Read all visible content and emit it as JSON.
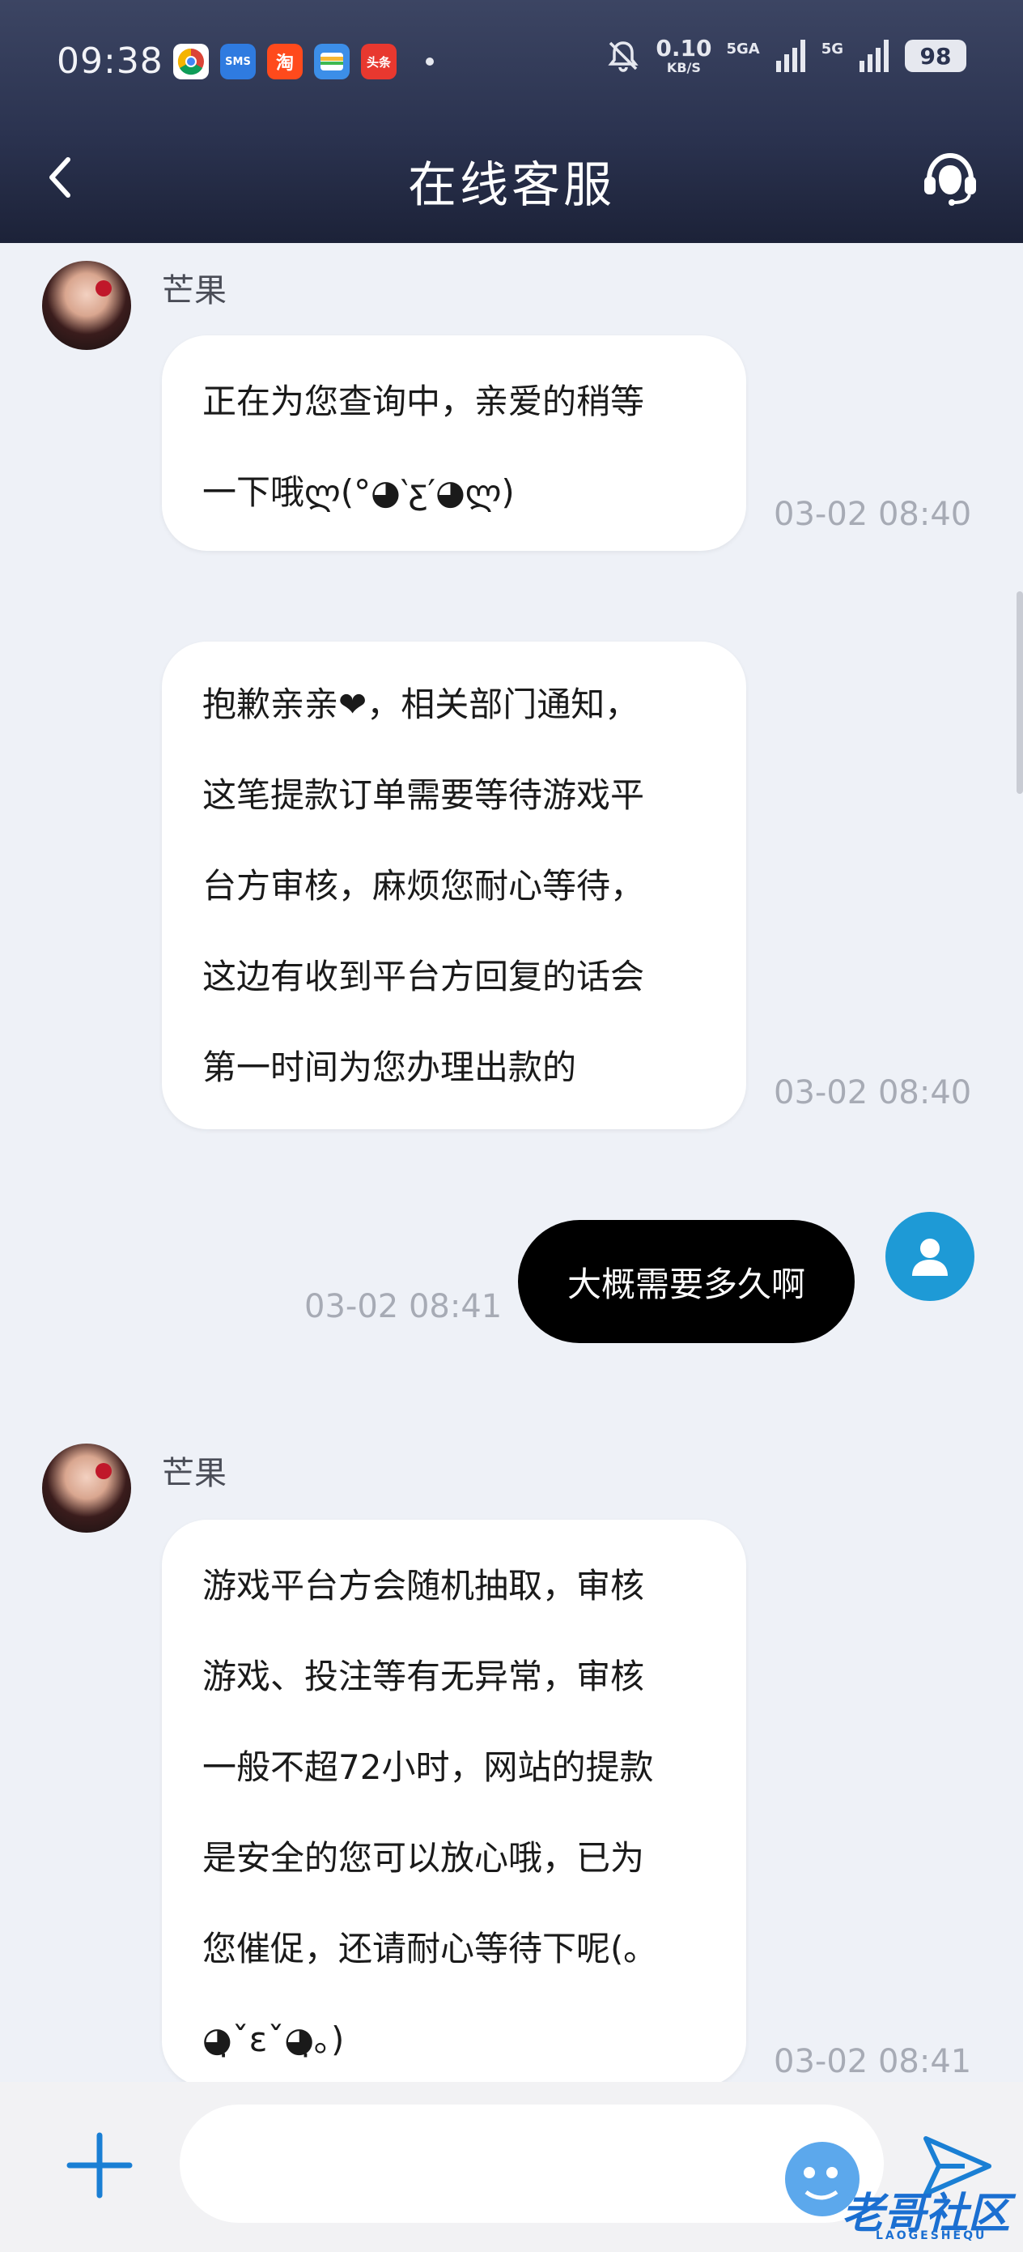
{
  "status_bar": {
    "time": "09:38",
    "apps": [
      {
        "icon": "chrome-icon",
        "color": "#ffffff",
        "label": ""
      },
      {
        "icon": "sms-icon",
        "color": "#2f7be0",
        "label": "SMS"
      },
      {
        "icon": "taobao-icon",
        "color": "#ff4a1c",
        "label": "淘"
      },
      {
        "icon": "wallet-icon",
        "color": "#3c8ee8",
        "label": ""
      },
      {
        "icon": "toutiao-icon",
        "color": "#e8382f",
        "label": "头条"
      }
    ],
    "net_speed_value": "0.10",
    "net_speed_unit": "KB/S",
    "signal1_label": "5GA",
    "signal2_label": "5G",
    "battery": "98"
  },
  "header": {
    "title": "在线客服",
    "back_icon": "chevron-left-icon",
    "service_icon": "headset-icon"
  },
  "messages": [
    {
      "direction": "in",
      "sender": "芒果",
      "text": "正在为您查询中，亲爱的稍等\n一下哦ლ(°◕‵ƹ′◕ლ)",
      "time": "03-02 08:40"
    },
    {
      "direction": "in",
      "sender": "",
      "text": "抱歉亲亲❤，相关部门通知，\n这笔提款订单需要等待游戏平\n台方审核，麻烦您耐心等待，\n这边有收到平台方回复的话会\n第一时间为您办理出款的",
      "time": "03-02 08:40"
    },
    {
      "direction": "out",
      "sender": "",
      "text": "大概需要多久啊",
      "time": "03-02 08:41"
    },
    {
      "direction": "in",
      "sender": "芒果",
      "text": "游戏平台方会随机抽取，审核\n游戏、投注等有无异常，审核\n一般不超72小时，网站的提款\n是安全的您可以放心哦，已为\n您催促，还请耐心等待下呢(｡\n◕̣ˇɛˇ◕̣｡)",
      "time": "03-02 08:41"
    }
  ],
  "input_bar": {
    "placeholder": "",
    "plus_icon": "plus-icon",
    "send_icon": "send-icon"
  },
  "watermark": {
    "text": "老哥社区",
    "sub": "LAOGESHEQU"
  }
}
